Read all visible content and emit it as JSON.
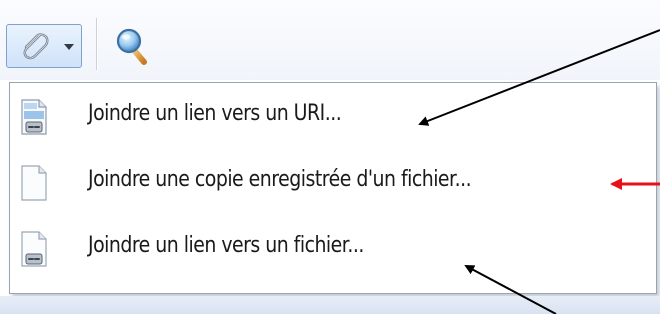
{
  "toolbar": {
    "attach_button": {
      "icon": "paperclip-icon",
      "dropdown_icon": "chevron-down-icon"
    },
    "search_button": {
      "icon": "magnifier-icon"
    }
  },
  "menu": {
    "items": [
      {
        "label": "Joindre un lien vers un URI...",
        "icon": "linked-document-icon"
      },
      {
        "label": "Joindre une copie enregistrée d'un fichier...",
        "icon": "blank-document-icon"
      },
      {
        "label": "Joindre un lien vers un fichier...",
        "icon": "linked-file-icon"
      }
    ]
  },
  "annotations": {
    "arrows": [
      {
        "target": "menu item 1",
        "color": "#000000"
      },
      {
        "target": "menu item 2",
        "color": "#e8111a"
      },
      {
        "target": "menu item 3",
        "color": "#000000"
      }
    ]
  }
}
